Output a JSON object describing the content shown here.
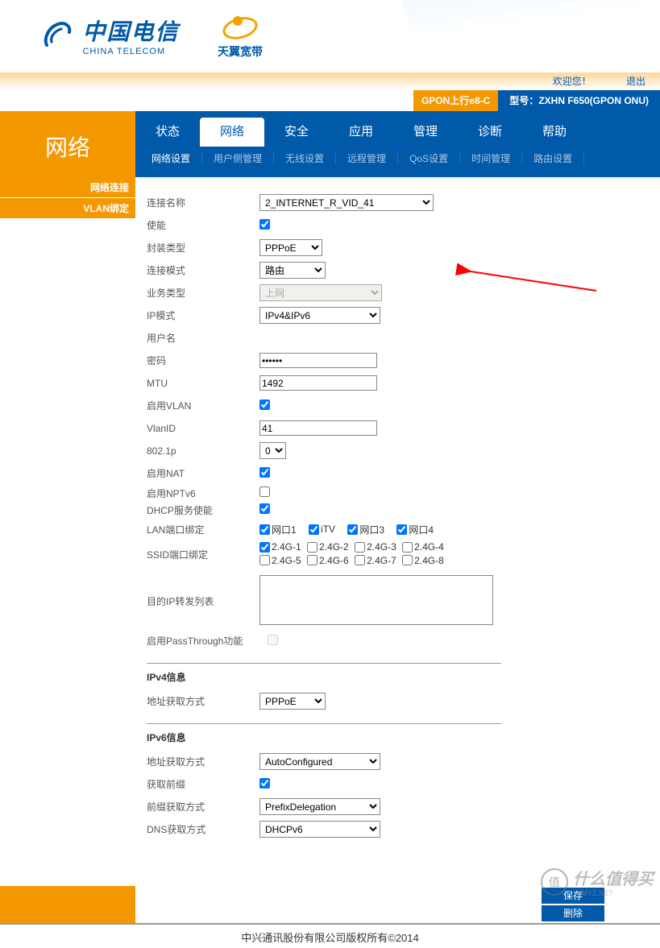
{
  "header": {
    "ct_zh": "中国电信",
    "ct_en": "CHINA TELECOM",
    "ty": "天翼宽带"
  },
  "infobar": {
    "welcome": "欢迎您！",
    "logout": "退出",
    "gpon": "GPON上行e8-C",
    "model_lbl": "型号：",
    "model_val": "ZXHN F650(GPON ONU)"
  },
  "cat_title": "网络",
  "tabs": [
    "状态",
    "网络",
    "安全",
    "应用",
    "管理",
    "诊断",
    "帮助"
  ],
  "active_tab": 1,
  "subtabs": [
    "网络设置",
    "用户侧管理",
    "无线设置",
    "远程管理",
    "QoS设置",
    "时间管理",
    "路由设置"
  ],
  "active_subtab": 0,
  "side": [
    "网络连接",
    "VLAN绑定"
  ],
  "form": {
    "conn_name_lbl": "连接名称",
    "conn_name_val": "2_INTERNET_R_VID_41",
    "enable_lbl": "使能",
    "encap_lbl": "封装类型",
    "encap_val": "PPPoE",
    "conn_mode_lbl": "连接模式",
    "conn_mode_val": "路由",
    "biz_lbl": "业务类型",
    "biz_val": "上网",
    "ip_mode_lbl": "IP模式",
    "ip_mode_val": "IPv4&IPv6",
    "user_lbl": "用户名",
    "user_val": "",
    "pwd_lbl": "密码",
    "pwd_val": "••••••",
    "mtu_lbl": "MTU",
    "mtu_val": "1492",
    "vlan_en_lbl": "启用VLAN",
    "vlanid_lbl": "VlanID",
    "vlanid_val": "41",
    "p8021_lbl": "802.1p",
    "p8021_val": "0",
    "nat_lbl": "启用NAT",
    "nptv6_lbl": "启用NPTv6",
    "dhcp_en_lbl": "DHCP服务使能",
    "lan_bind_lbl": "LAN端口绑定",
    "lan_ports": [
      "网口1",
      "iTV",
      "网口3",
      "网口4"
    ],
    "ssid_bind_lbl": "SSID端口绑定",
    "ssid_ports_r1": [
      "2.4G-1",
      "2.4G-2",
      "2.4G-3",
      "2.4G-4"
    ],
    "ssid_ports_r2": [
      "2.4G-5",
      "2.4G-6",
      "2.4G-7",
      "2.4G-8"
    ],
    "dst_fwd_lbl": "目的IP转发列表",
    "passthrough_lbl": "启用PassThrough功能",
    "ipv4_title": "IPv4信息",
    "ipv4_addr_lbl": "地址获取方式",
    "ipv4_addr_val": "PPPoE",
    "ipv6_title": "IPv6信息",
    "ipv6_addr_lbl": "地址获取方式",
    "ipv6_addr_val": "AutoConfigured",
    "prefix_en_lbl": "获取前缀",
    "prefix_mode_lbl": "前缀获取方式",
    "prefix_mode_val": "PrefixDelegation",
    "dns_mode_lbl": "DNS获取方式",
    "dns_mode_val": "DHCPv6"
  },
  "actions": {
    "save": "保存",
    "delete": "删除"
  },
  "copyright": "中兴通讯股份有限公司版权所有©2014",
  "watermark": {
    "badge": "值",
    "text": "什么值得买",
    "sub": ".SMYZ.NET"
  }
}
